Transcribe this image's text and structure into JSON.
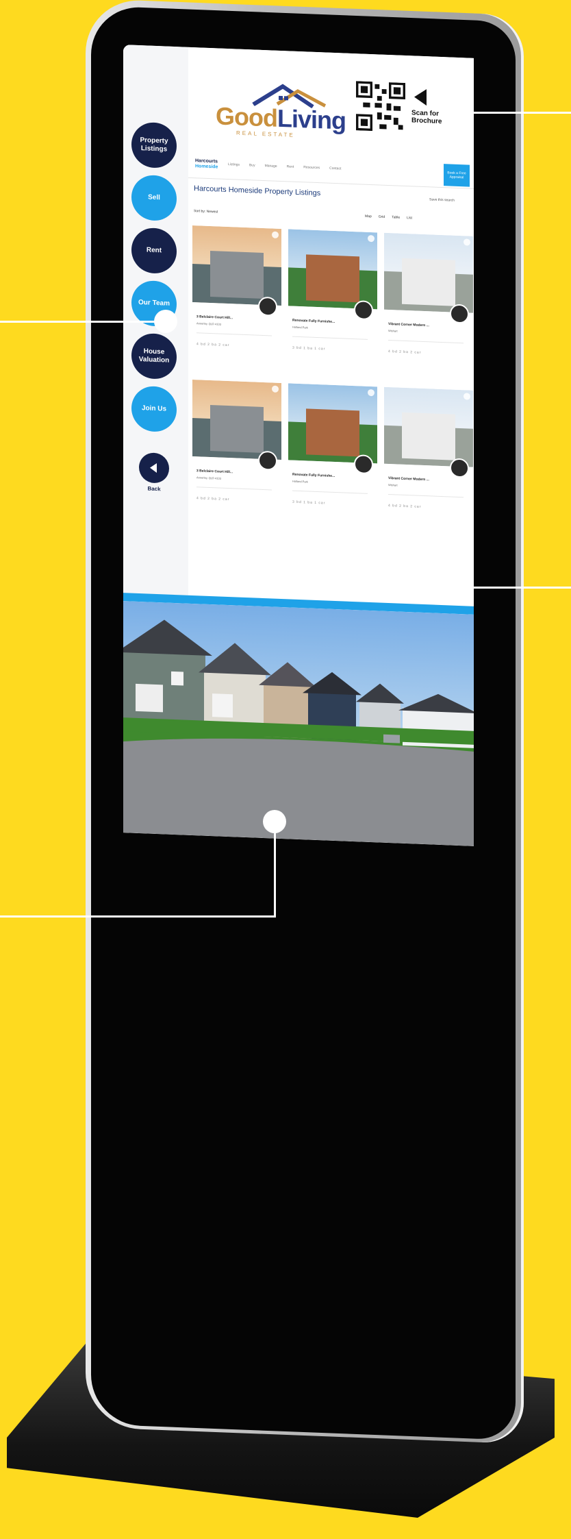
{
  "brand": {
    "logo_good": "Good",
    "logo_living": "Living",
    "logo_sub": "REAL ESTATE",
    "qr_label": "Scan for Brochure"
  },
  "side_nav": {
    "items": [
      {
        "label": "Property Listings",
        "style": "dark"
      },
      {
        "label": "Sell",
        "style": "light"
      },
      {
        "label": "Rent",
        "style": "dark"
      },
      {
        "label": "Our Team",
        "style": "light"
      },
      {
        "label": "House Valuation",
        "style": "dark"
      },
      {
        "label": "Join Us",
        "style": "light"
      }
    ],
    "back_label": "Back"
  },
  "header": {
    "brand_line1": "Harcourts",
    "brand_line2": "Homeside",
    "menu": [
      "Listings",
      "Buy",
      "Manage",
      "Rent",
      "Resources",
      "Contact"
    ],
    "cta": "Book a Free Appraisal"
  },
  "main": {
    "title": "Harcourts Homeside Property Listings",
    "save_search": "Save this search",
    "sort": "Sort by: Newest",
    "views": [
      "Map",
      "Grid",
      "Table",
      "List"
    ]
  },
  "listings": [
    {
      "title": "3 Belclaire Court Hill...",
      "sub": "Annerley, QLD 4103",
      "feats": "4 bd  2 ba  2 car",
      "kind": "aerial"
    },
    {
      "title": "Renovate Fully Furnishe...",
      "sub": "Holland Park",
      "feats": "3 bd  1 ba  1 car",
      "kind": "brick"
    },
    {
      "title": "Vibrant Corner Modern ...",
      "sub": "Wishart",
      "feats": "4 bd  2 ba  2 car",
      "kind": "modern"
    },
    {
      "title": "3 Belclaire Court Hill...",
      "sub": "Annerley, QLD 4103",
      "feats": "4 bd  2 ba  2 car",
      "kind": "aerial"
    },
    {
      "title": "Renovate Fully Furnishe...",
      "sub": "Holland Park",
      "feats": "3 bd  1 ba  1 car",
      "kind": "brick"
    },
    {
      "title": "Vibrant Corner Modern ...",
      "sub": "Wishart",
      "feats": "4 bd  2 ba  2 car",
      "kind": "modern"
    }
  ],
  "colors": {
    "background": "#FEDA1F",
    "navy": "#16214a",
    "sky_blue": "#1fa2e8",
    "gold": "#c9903d"
  }
}
